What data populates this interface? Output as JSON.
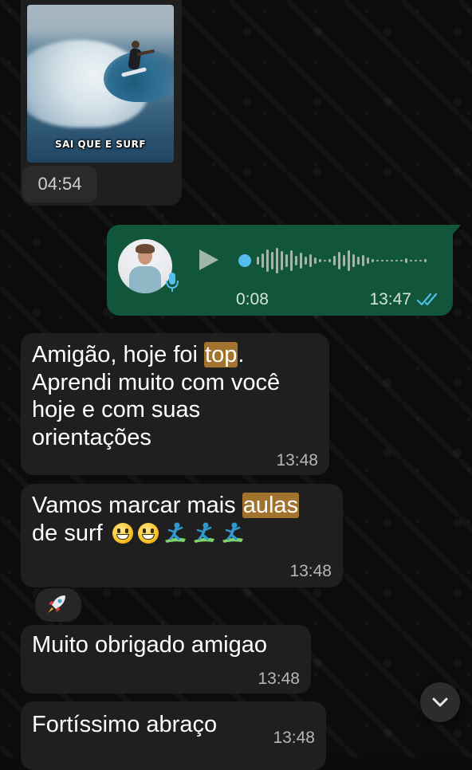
{
  "media_message": {
    "thumbnail_caption": "SAI QUE E SURF",
    "video_duration": "04:54"
  },
  "voice_message": {
    "duration": "0:08",
    "time": "13:47",
    "status_icon": "double-check-icon"
  },
  "messages": [
    {
      "before": "Amigão, hoje foi ",
      "highlight": "top",
      "after": ".",
      "line2": "Aprendi muito com você",
      "line3": "hoje e com suas",
      "line4": "orientações",
      "time": "13:48"
    },
    {
      "before": "Vamos marcar mais ",
      "highlight": "aulas",
      "line2": "de surf",
      "emojis": [
        "grinning-face-emoji",
        "grinning-face-emoji",
        "person-surfing-emoji",
        "person-surfing-emoji",
        "person-surfing-emoji"
      ],
      "time": "13:48"
    },
    {
      "text": "Muito obrigado amigao",
      "time": "13:48"
    },
    {
      "text": "Fortíssimo abraço",
      "time": "13:48"
    }
  ],
  "reaction": {
    "emoji": "rocket-emoji"
  },
  "controls": {
    "scroll_down_icon": "chevron-down-icon"
  },
  "colors": {
    "outgoing_bubble": "#11553b",
    "incoming_bubble": "#1f1f1f",
    "highlight": "#a2722f",
    "read_ticks": "#53bdeb",
    "background": "#0b0b0b"
  }
}
